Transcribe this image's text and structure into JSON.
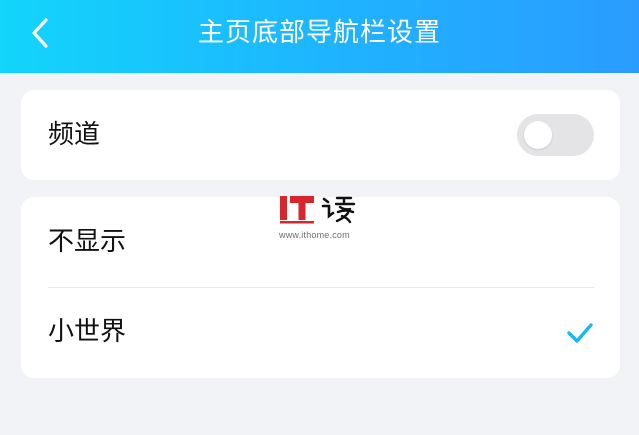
{
  "header": {
    "title": "主页底部导航栏设置",
    "back_icon": "chevron-left-icon"
  },
  "channel_card": {
    "label": "频道",
    "toggle_state": "off"
  },
  "options_card": {
    "items": [
      {
        "label": "不显示",
        "selected": false
      },
      {
        "label": "小世界",
        "selected": true
      }
    ],
    "check_icon": "checkmark-icon"
  },
  "watermark": {
    "logo_text": "IT之家",
    "url": "www.ithome.com"
  },
  "colors": {
    "header_gradient_start": "#12d5fb",
    "header_gradient_end": "#2a9cff",
    "accent": "#1bb6f5",
    "background": "#f2f3f7",
    "toggle_off": "#e4e4e6",
    "watermark_red": "#d8262d"
  }
}
